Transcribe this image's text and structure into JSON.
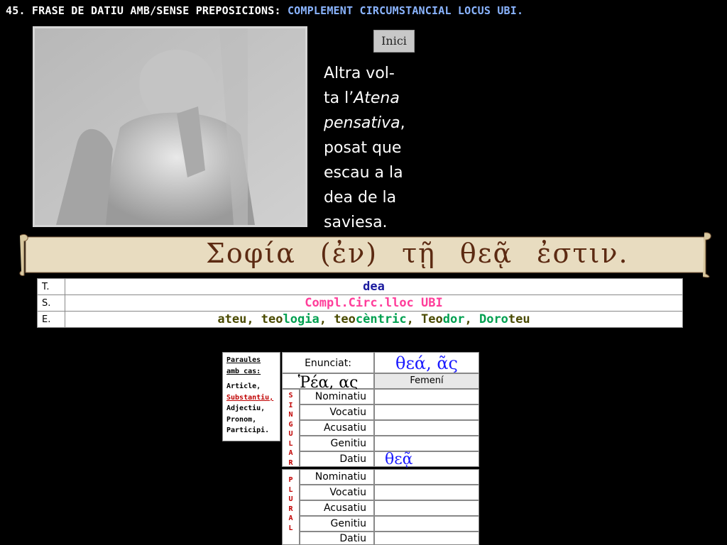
{
  "header": {
    "title_main": "45. FRASE DE DATIU AMB/SENSE PREPOSICIONS: ",
    "title_highlight": "COMPLEMENT CIRCUMSTANCIAL LOCUS UBI."
  },
  "nav": {
    "home_label": "Inici"
  },
  "caption": {
    "line1": "Altra vol-",
    "line2_prefix": "ta l’",
    "line2_italic": "Atena",
    "line3_italic": "pensativa",
    "line3_suffix": ",",
    "line4": "posat que",
    "line5": "escau a la",
    "line6": "dea de la",
    "line7": "saviesa."
  },
  "sentence": {
    "words": [
      "Σοφία",
      "(ἐν)",
      "τῇ",
      "θεᾷ",
      "ἐστιν."
    ]
  },
  "tse": {
    "rows": [
      {
        "key": "T.",
        "value": "dea"
      },
      {
        "key": "S.",
        "value": "Compl.Circ.lloc UBI"
      },
      {
        "key": "E.",
        "prefix_parts": [
          "",
          "ateu",
          ", ",
          "teo",
          "logia",
          ", ",
          "teo",
          "cèntric",
          ", ",
          "Teo",
          "dor",
          ", ",
          "Doro",
          "teu"
        ]
      }
    ]
  },
  "legend": {
    "title": "Paraules amb cas:",
    "items": [
      "Article,",
      "Substantiu,",
      "Adjectiu,",
      "Pronom,",
      "Participi."
    ]
  },
  "declension": {
    "enunciat_label": "Enunciat:",
    "enunciat_value": "θεά, ᾶς",
    "example": "Ῥέα, ας",
    "gender": "Femení",
    "singular_letters": [
      "S",
      "I",
      "N",
      "G",
      "U",
      "L",
      "A",
      "R"
    ],
    "plural_letters": [
      "P",
      "L",
      "U",
      "R",
      "A",
      "L"
    ],
    "cases": [
      "Nominatiu",
      "Vocatiu",
      "Acusatiu",
      "Genitiu",
      "Datiu"
    ],
    "singular_values": {
      "Datiu": "θεᾷ"
    },
    "colors": {
      "stem": "#1a1aff",
      "ending": "#ff2d2d",
      "legend_red": "#c00000"
    }
  }
}
